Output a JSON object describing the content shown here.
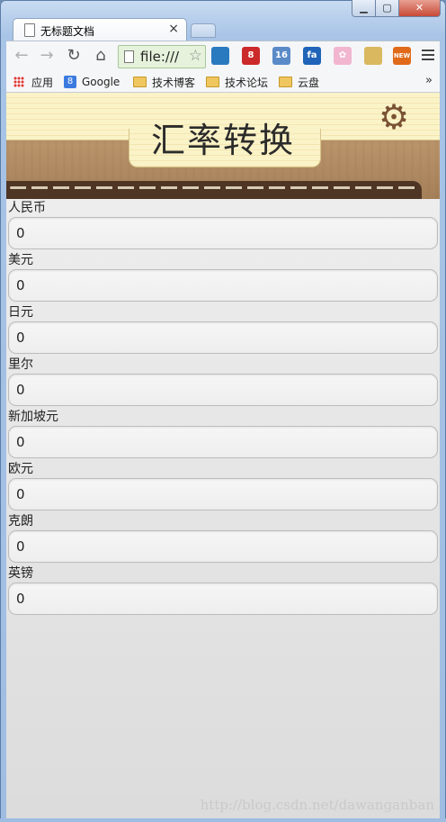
{
  "browser": {
    "tab_title": "无标题文档",
    "tab_close": "×",
    "address": "file:///",
    "bookmarks": [
      {
        "label": "应用",
        "icon": "apps-grid-icon"
      },
      {
        "label": "Google",
        "icon": "google-icon"
      },
      {
        "label": "技术博客",
        "icon": "folder-icon"
      },
      {
        "label": "技术论坛",
        "icon": "folder-icon"
      },
      {
        "label": "云盘",
        "icon": "folder-icon"
      }
    ],
    "bookmarks_overflow": "»",
    "extensions": [
      {
        "name": "photo-ext-icon",
        "color": "#2a7ac0",
        "text": ""
      },
      {
        "name": "weibo-ext-icon",
        "color": "#cc2a2a",
        "text": "8"
      },
      {
        "name": "weather-ext-icon",
        "color": "#5a8ac8",
        "text": "16"
      },
      {
        "name": "fa-ext-icon",
        "color": "#1f64b8",
        "text": "fa"
      },
      {
        "name": "flower-ext-icon",
        "color": "#f2b6d0",
        "text": "✿"
      },
      {
        "name": "notes-ext-icon",
        "color": "#d9b860",
        "text": ""
      },
      {
        "name": "new-ext-icon",
        "color": "#e06a1a",
        "text": "NEW"
      }
    ]
  },
  "app": {
    "title": "汇率转换",
    "settings_icon": "gear-icon",
    "currencies": [
      {
        "label": "人民币",
        "value": "0"
      },
      {
        "label": "美元",
        "value": "0"
      },
      {
        "label": "日元",
        "value": "0"
      },
      {
        "label": "里尔",
        "value": "0"
      },
      {
        "label": "新加坡元",
        "value": "0"
      },
      {
        "label": "欧元",
        "value": "0"
      },
      {
        "label": "克朗",
        "value": "0"
      },
      {
        "label": "英镑",
        "value": "0"
      }
    ]
  },
  "watermark": "http://blog.csdn.net/dawanganban"
}
